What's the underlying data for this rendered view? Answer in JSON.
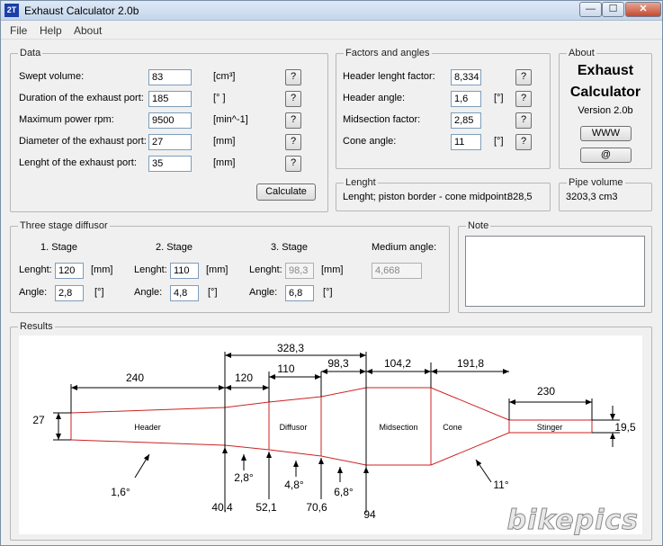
{
  "window": {
    "title": "Exhaust Calculator 2.0b",
    "app_icon": "2T"
  },
  "menu": [
    "File",
    "Help",
    "About"
  ],
  "data": {
    "legend": "Data",
    "fields": [
      {
        "label": "Swept volume:",
        "value": "83",
        "unit": "[cm³]"
      },
      {
        "label": "Duration of the exhaust port:",
        "value": "185",
        "unit": "[° ]"
      },
      {
        "label": "Maximum power rpm:",
        "value": "9500",
        "unit": "[min^-1]"
      },
      {
        "label": "Diameter of the exhaust port:",
        "value": "27",
        "unit": "[mm]"
      },
      {
        "label": "Lenght of the exhaust port:",
        "value": "35",
        "unit": "[mm]"
      }
    ],
    "help": "?",
    "calculate": "Calculate"
  },
  "factors": {
    "legend": "Factors and angles",
    "fields": [
      {
        "label": "Header lenght factor:",
        "value": "8,334",
        "unit": ""
      },
      {
        "label": "Header angle:",
        "value": "1,6",
        "unit": "[°]"
      },
      {
        "label": "Midsection factor:",
        "value": "2,85",
        "unit": ""
      },
      {
        "label": "Cone angle:",
        "value": "11",
        "unit": "[°]"
      }
    ]
  },
  "about": {
    "legend": "About",
    "line1": "Exhaust",
    "line2": "Calculator",
    "version": "Version 2.0b",
    "www": "WWW",
    "at": "@"
  },
  "lenght": {
    "legend": "Lenght",
    "text": "Lenght; piston border - cone midpoint:",
    "value": "828,5"
  },
  "pipe": {
    "legend": "Pipe volume",
    "value": "3203,3 cm3"
  },
  "diffusor": {
    "legend": "Three stage diffusor",
    "stages": [
      {
        "title": "1. Stage",
        "lenght": "120",
        "angle": "2,8"
      },
      {
        "title": "2. Stage",
        "lenght": "110",
        "angle": "4,8"
      },
      {
        "title": "3. Stage",
        "lenght": "98,3",
        "angle": "6,8"
      }
    ],
    "lenght_label": "Lenght:",
    "angle_label": "Angle:",
    "mm": "[mm]",
    "deg": "[°]",
    "medium_label": "Medium angle:",
    "medium_value": "4,668"
  },
  "note": {
    "legend": "Note",
    "text": ""
  },
  "results": {
    "legend": "Results",
    "sections": [
      "Header",
      "Diffusor",
      "Midsection",
      "Cone",
      "Stinger"
    ],
    "top_dims": [
      "240",
      "120",
      "110",
      "98,3",
      "104,2",
      "191,8",
      "230",
      "328,3"
    ],
    "left_dia": "27",
    "right_dia": "19,5",
    "angles": [
      "1,6°",
      "2,8°",
      "4,8°",
      "6,8°",
      "11°"
    ],
    "positions": [
      "40,4",
      "52,1",
      "70,6",
      "94"
    ]
  },
  "watermark": "bikepics",
  "colors": {
    "pipe": "#cc2222",
    "dim": "#000000"
  }
}
